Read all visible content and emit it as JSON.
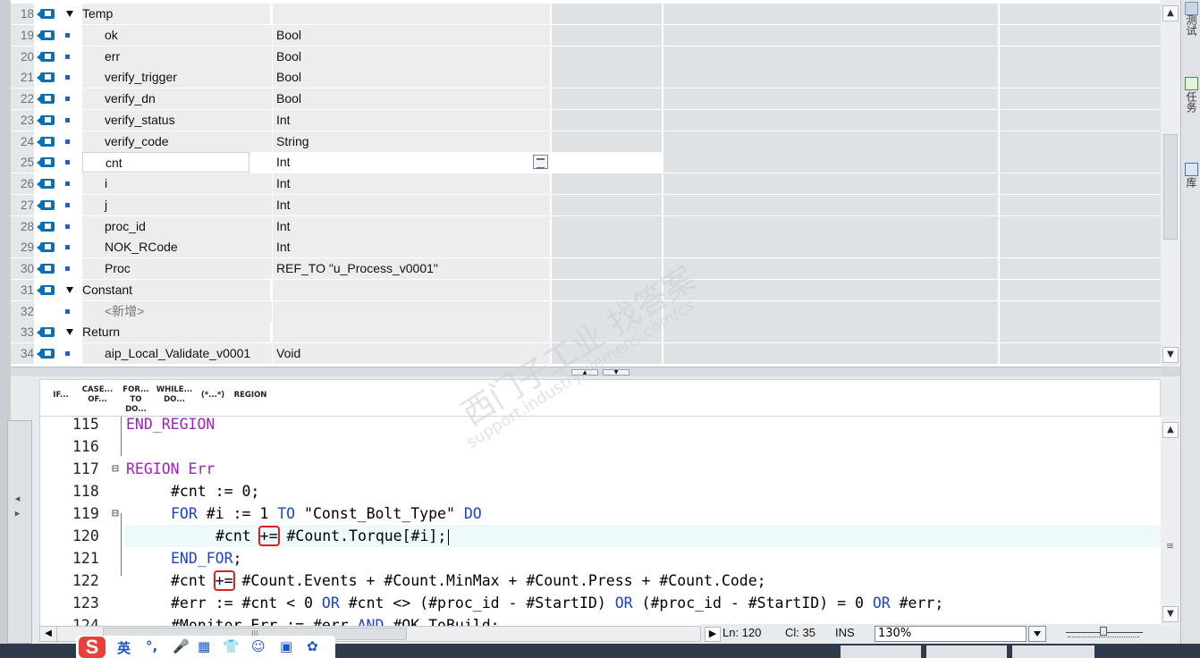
{
  "variables": {
    "rows": [
      {
        "num": "18",
        "kind": "section",
        "name": "Temp",
        "type": ""
      },
      {
        "num": "19",
        "kind": "item",
        "name": "ok",
        "type": "Bool"
      },
      {
        "num": "20",
        "kind": "item",
        "name": "err",
        "type": "Bool"
      },
      {
        "num": "21",
        "kind": "item",
        "name": "verify_trigger",
        "type": "Bool"
      },
      {
        "num": "22",
        "kind": "item",
        "name": "verify_dn",
        "type": "Bool"
      },
      {
        "num": "23",
        "kind": "item",
        "name": "verify_status",
        "type": "Int"
      },
      {
        "num": "24",
        "kind": "item",
        "name": "verify_code",
        "type": "String"
      },
      {
        "num": "25",
        "kind": "item",
        "name": "cnt",
        "type": "Int",
        "selected": true
      },
      {
        "num": "26",
        "kind": "item",
        "name": "i",
        "type": "Int"
      },
      {
        "num": "27",
        "kind": "item",
        "name": "j",
        "type": "Int"
      },
      {
        "num": "28",
        "kind": "item",
        "name": "proc_id",
        "type": "Int"
      },
      {
        "num": "29",
        "kind": "item",
        "name": "NOK_RCode",
        "type": "Int"
      },
      {
        "num": "30",
        "kind": "item",
        "name": "Proc",
        "type": "REF_TO \"u_Process_v0001\""
      },
      {
        "num": "31",
        "kind": "section",
        "name": "Constant",
        "type": ""
      },
      {
        "num": "32",
        "kind": "add",
        "name": "<新增>",
        "type": ""
      },
      {
        "num": "33",
        "kind": "section",
        "name": "Return",
        "type": ""
      },
      {
        "num": "34",
        "kind": "item",
        "name": "aip_Local_Validate_v0001",
        "type": "Void"
      }
    ]
  },
  "toolbar": {
    "buttons": [
      {
        "line1": "IF...",
        "line2": ""
      },
      {
        "line1": "CASE...",
        "line2": "OF..."
      },
      {
        "line1": "FOR...",
        "line2": "TO DO..."
      },
      {
        "line1": "WHILE...",
        "line2": "DO..."
      },
      {
        "line1": "(*...*)",
        "line2": ""
      },
      {
        "line1": "REGION",
        "line2": ""
      }
    ]
  },
  "code": {
    "lines": [
      {
        "ln": "115",
        "fold": "",
        "html": [
          [
            "rg",
            "END_REGION"
          ]
        ],
        "indent": 0
      },
      {
        "ln": "116",
        "fold": "",
        "html": [],
        "indent": 0
      },
      {
        "ln": "117",
        "fold": "⊟",
        "html": [
          [
            "rg",
            "REGION"
          ],
          [
            "txt",
            " "
          ],
          [
            "rg",
            "Err"
          ]
        ],
        "indent": 0
      },
      {
        "ln": "118",
        "fold": "",
        "html": [
          [
            "txt",
            "#cnt := 0;"
          ]
        ],
        "indent": 1
      },
      {
        "ln": "119",
        "fold": "⊟",
        "html": [
          [
            "kw",
            "FOR"
          ],
          [
            "txt",
            " #i := 1 "
          ],
          [
            "kw",
            "TO"
          ],
          [
            "txt",
            " \"Const_Bolt_Type\" "
          ],
          [
            "kw",
            "DO"
          ]
        ],
        "indent": 1
      },
      {
        "ln": "120",
        "fold": "",
        "html": [
          [
            "txt",
            "#cnt "
          ],
          [
            "box",
            "+="
          ],
          [
            "txt",
            " #Count.Torque[#i];"
          ]
        ],
        "indent": 2,
        "current": true
      },
      {
        "ln": "121",
        "fold": "",
        "html": [
          [
            "kw",
            "END_FOR"
          ],
          [
            "txt",
            ";"
          ]
        ],
        "indent": 1
      },
      {
        "ln": "122",
        "fold": "",
        "html": [
          [
            "txt",
            "#cnt "
          ],
          [
            "box",
            "+="
          ],
          [
            "txt",
            " #Count.Events + #Count.MinMax + #Count.Press + #Count.Code;"
          ]
        ],
        "indent": 1
      },
      {
        "ln": "123",
        "fold": "",
        "html": [
          [
            "txt",
            "#err := #cnt < 0 "
          ],
          [
            "kw",
            "OR"
          ],
          [
            "txt",
            " #cnt <> (#proc_id - #StartID) "
          ],
          [
            "kw",
            "OR"
          ],
          [
            "txt",
            " (#proc_id - #StartID) = 0 "
          ],
          [
            "kw",
            "OR"
          ],
          [
            "txt",
            " #err;"
          ]
        ],
        "indent": 1
      },
      {
        "ln": "124",
        "fold": "",
        "html": [
          [
            "txt",
            "#Monitor.Err := #err "
          ],
          [
            "kw",
            "AND"
          ],
          [
            "txt",
            " #OK_ToBuild;"
          ]
        ],
        "indent": 1
      }
    ]
  },
  "status": {
    "ln_label": "Ln: 120",
    "cl_label": "Cl: 35",
    "mode": "INS",
    "zoom": "130%"
  },
  "right_tabs": [
    "测试",
    "任务",
    "库"
  ],
  "watermark": {
    "line1": "西门子工业 找答案",
    "line2": "support.industry.siemens.com/cs"
  },
  "ime": {
    "label": "英"
  },
  "colors": {
    "keyword": "#1a45c8",
    "region": "#a020c0",
    "highlight_box": "#e02020"
  }
}
